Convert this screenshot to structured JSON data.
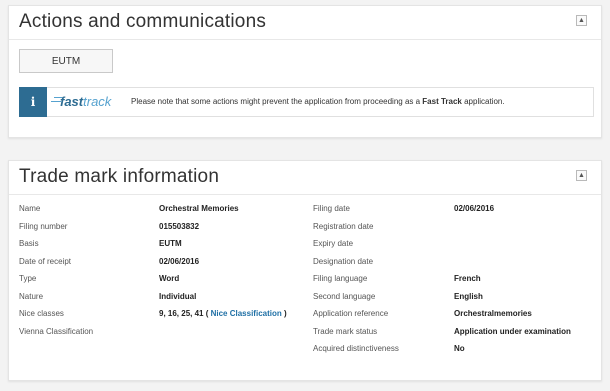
{
  "actions": {
    "title": "Actions and communications",
    "collapse_symbol": "▲",
    "eutm_button": "EUTM",
    "fast_track": {
      "icon_text": "i",
      "logo_fast": "fast",
      "logo_track": "track",
      "message_prefix": "Please note that some actions might prevent the application from proceeding as a",
      "message_bold": "Fast Track",
      "message_suffix": "application."
    }
  },
  "trademark": {
    "title": "Trade mark information",
    "collapse_symbol": "▲",
    "left": [
      {
        "label": "Name",
        "value": "Orchestral Memories"
      },
      {
        "label": "Filing number",
        "value": "015503832"
      },
      {
        "label": "Basis",
        "value": "EUTM"
      },
      {
        "label": "Date of receipt",
        "value": "02/06/2016"
      },
      {
        "label": "Type",
        "value": "Word"
      },
      {
        "label": "Nature",
        "value": "Individual"
      },
      {
        "label": "Nice classes",
        "value": "9, 16, 25, 41 (",
        "link": "Nice Classification",
        "value_end": ")"
      },
      {
        "label": "Vienna Classification",
        "value": ""
      }
    ],
    "right": [
      {
        "label": "Filing date",
        "value": "02/06/2016"
      },
      {
        "label": "Registration date",
        "value": ""
      },
      {
        "label": "Expiry date",
        "value": ""
      },
      {
        "label": "Designation date",
        "value": ""
      },
      {
        "label": "Filing language",
        "value": "French"
      },
      {
        "label": "Second language",
        "value": "English"
      },
      {
        "label": "Application reference",
        "value": "Orchestralmemories"
      },
      {
        "label": "Trade mark status",
        "value": "Application under examination"
      },
      {
        "label": "Acquired distinctiveness",
        "value": "No"
      }
    ]
  }
}
